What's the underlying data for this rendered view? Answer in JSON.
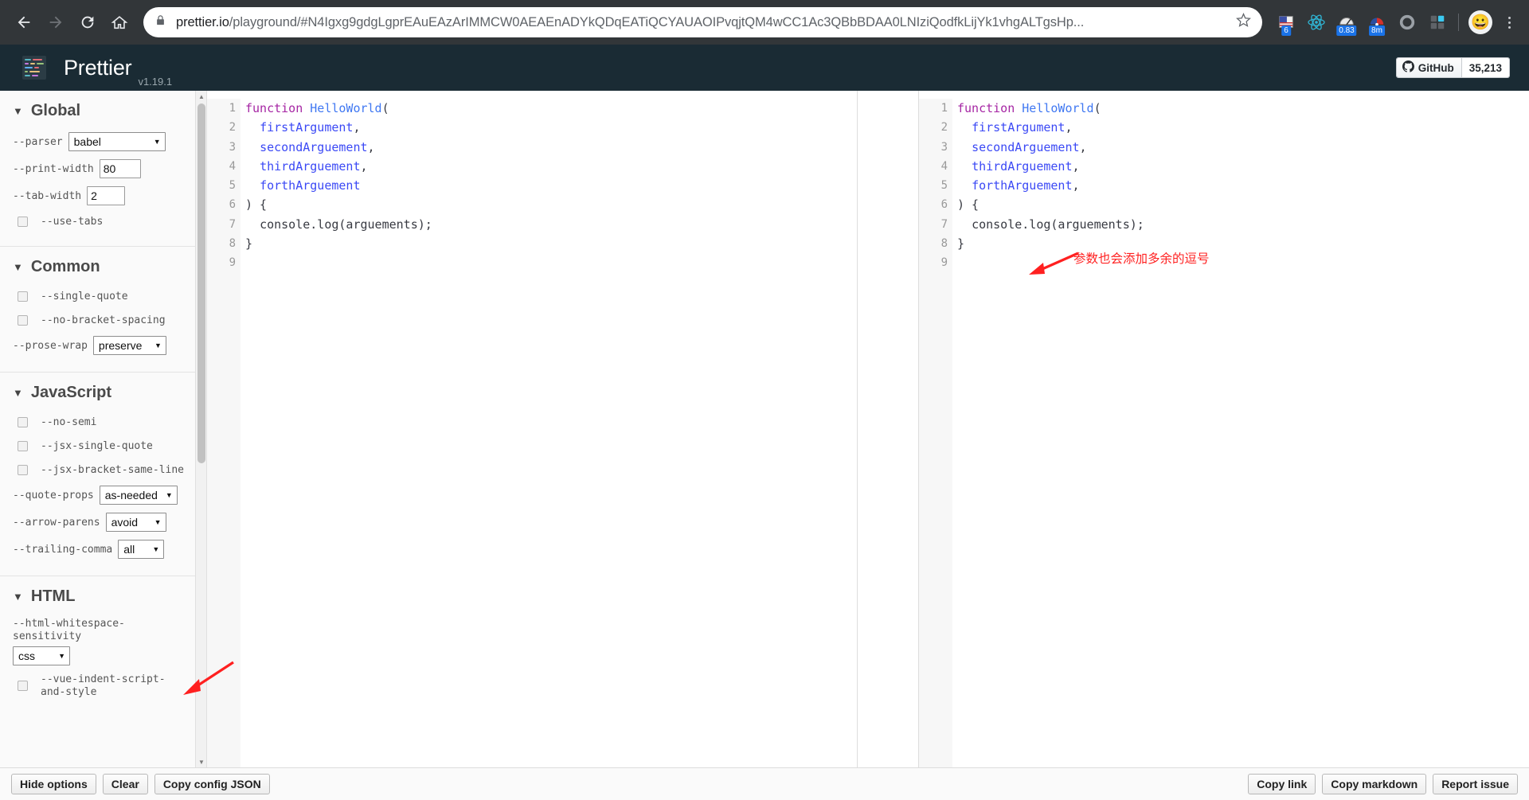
{
  "browser": {
    "back_icon": "back-arrow-icon",
    "forward_icon": "forward-arrow-icon",
    "reload_icon": "reload-icon",
    "home_icon": "home-icon",
    "lock_icon": "lock-icon",
    "url_host": "prettier.io",
    "url_path": "/playground/#N4Igxg9gdgLgprEAuEAzArIMMCW0AEAEnADYkQDqEATiQCYAUAOIPvqjtQM4wCC1Ac3QBbBDAA0LNIziQodfkLijYk1vhgALTgsHp...",
    "star_icon": "star-icon",
    "extensions": [
      {
        "name": "flag-extension-icon",
        "badge": "6"
      },
      {
        "name": "react-devtools-icon",
        "badge": ""
      },
      {
        "name": "speed-gauge-icon",
        "badge": "0.83"
      },
      {
        "name": "timer-gauge-icon",
        "badge": "8m"
      },
      {
        "name": "ring-extension-icon",
        "badge": ""
      },
      {
        "name": "puzzle-extensions-icon",
        "badge": ""
      }
    ],
    "avatar_icon": "emoji-avatar-icon",
    "menu_icon": "three-dot-menu-icon"
  },
  "header": {
    "logo_icon": "prettier-logo-icon",
    "title": "Prettier",
    "version": "v1.19.1",
    "github": {
      "icon": "github-icon",
      "label": "GitHub",
      "stars": "35,213"
    }
  },
  "sidebar": {
    "scroll_up_icon": "chevron-up-icon",
    "scroll_down_icon": "chevron-down-icon",
    "sections": [
      {
        "title": "Global",
        "caret": "▼",
        "options": [
          {
            "label": "--parser",
            "type": "select",
            "value": "babel",
            "arrow": "▼"
          },
          {
            "label": "--print-width",
            "type": "text",
            "value": "80"
          },
          {
            "label": "--tab-width",
            "type": "text",
            "value": "2"
          },
          {
            "label": "--use-tabs",
            "type": "checkbox",
            "checked": false
          }
        ]
      },
      {
        "title": "Common",
        "caret": "▼",
        "options": [
          {
            "label": "--single-quote",
            "type": "checkbox",
            "checked": false
          },
          {
            "label": "--no-bracket-spacing",
            "type": "checkbox",
            "checked": false
          },
          {
            "label": "--prose-wrap",
            "type": "select",
            "value": "preserve",
            "arrow": "▼"
          }
        ]
      },
      {
        "title": "JavaScript",
        "caret": "▼",
        "options": [
          {
            "label": "--no-semi",
            "type": "checkbox",
            "checked": false
          },
          {
            "label": "--jsx-single-quote",
            "type": "checkbox",
            "checked": false
          },
          {
            "label": "--jsx-bracket-same-line",
            "type": "checkbox",
            "checked": false
          },
          {
            "label": "--quote-props",
            "type": "select",
            "value": "as-needed",
            "arrow": "▼"
          },
          {
            "label": "--arrow-parens",
            "type": "select",
            "value": "avoid",
            "arrow": "▼"
          },
          {
            "label": "--trailing-comma",
            "type": "select",
            "value": "all",
            "arrow": "▼"
          }
        ]
      },
      {
        "title": "HTML",
        "caret": "▼",
        "options": [
          {
            "label": "--html-whitespace-sensitivity",
            "type": "select",
            "value": "css",
            "arrow": "▼"
          },
          {
            "label": "--vue-indent-script-and-style",
            "type": "checkbox",
            "checked": false
          }
        ]
      }
    ]
  },
  "editors": {
    "input": {
      "line_numbers": [
        "1",
        "2",
        "3",
        "4",
        "5",
        "6",
        "7",
        "8",
        "9"
      ],
      "lines": [
        "function HelloWorld(",
        "  firstArgument,",
        "  secondArguement,",
        "  thirdArguement,",
        "  forthArguement",
        ") {",
        "  console.log(arguements);",
        "}",
        ""
      ]
    },
    "output": {
      "line_numbers": [
        "1",
        "2",
        "3",
        "4",
        "5",
        "6",
        "7",
        "8",
        "9"
      ],
      "lines": [
        "function HelloWorld(",
        "  firstArgument,",
        "  secondArguement,",
        "  thirdArguement,",
        "  forthArguement,",
        ") {",
        "  console.log(arguements);",
        "}",
        ""
      ]
    }
  },
  "annotations": {
    "comma_note": "参数也会添加多余的逗号",
    "comma_arrow_icon": "red-arrow-icon",
    "trailing_comma_arrow_icon": "red-arrow-icon",
    "color": "#ff2020"
  },
  "footer": {
    "left_buttons": [
      "Hide options",
      "Clear",
      "Copy config JSON"
    ],
    "right_buttons": [
      "Copy link",
      "Copy markdown",
      "Report issue"
    ]
  },
  "colors": {
    "header_bg": "#1a2b34",
    "chrome_bg": "#323639",
    "keyword": "#a626a4",
    "function_name": "#4078f2",
    "identifier": "#3b49f5",
    "annotation_red": "#ff2020"
  }
}
